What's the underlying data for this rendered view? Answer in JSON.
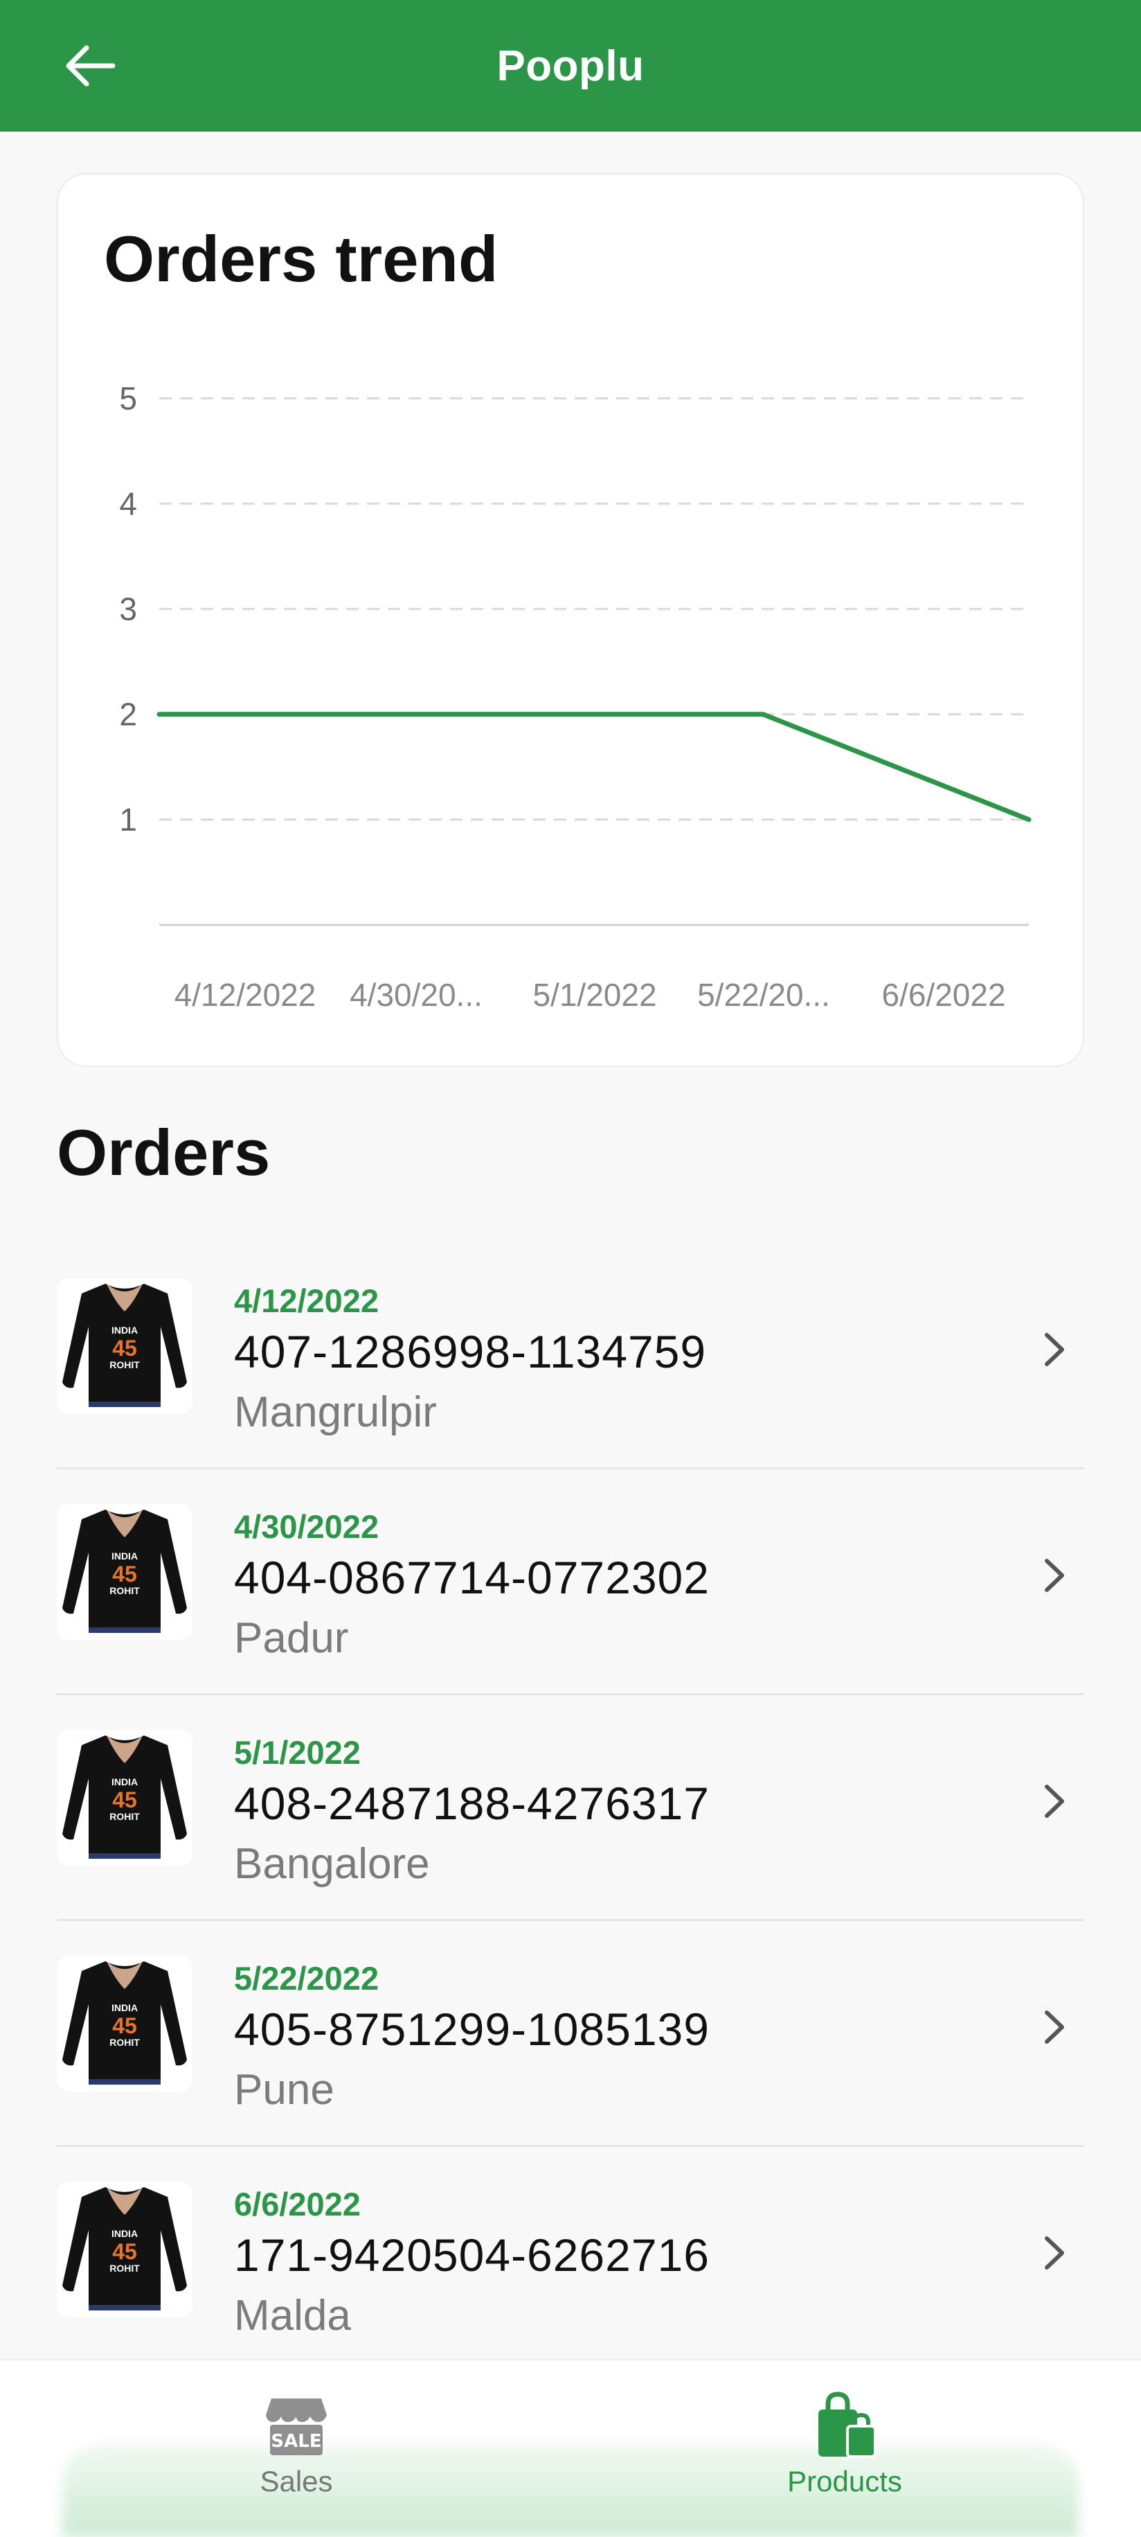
{
  "app": {
    "title": "Pooplu"
  },
  "chart_data": {
    "type": "line",
    "title": "Orders trend",
    "xlabel": "",
    "ylabel": "",
    "categories": [
      "4/12/2022",
      "4/30/20...",
      "5/1/2022",
      "5/22/20...",
      "6/6/2022"
    ],
    "series": [
      {
        "values": [
          2,
          2,
          2,
          2,
          1
        ]
      }
    ],
    "yticks": [
      1,
      2,
      3,
      4,
      5
    ],
    "ylim": [
      0,
      5
    ],
    "grid": true,
    "color": "#2b9648"
  },
  "orders_section": {
    "title": "Orders"
  },
  "orders": [
    {
      "date": "4/12/2022",
      "id": "407-1286998-1134759",
      "city": "Mangrulpir"
    },
    {
      "date": "4/30/2022",
      "id": "404-0867714-0772302",
      "city": "Padur"
    },
    {
      "date": "5/1/2022",
      "id": "408-2487188-4276317",
      "city": "Bangalore"
    },
    {
      "date": "5/22/2022",
      "id": "405-8751299-1085139",
      "city": "Pune"
    },
    {
      "date": "6/6/2022",
      "id": "171-9420504-6262716",
      "city": "Malda"
    }
  ],
  "thumbnail": {
    "shirt_text_top": "INDIA",
    "shirt_text_number": "45",
    "shirt_text_bottom": "ROHIT"
  },
  "bottom_nav": {
    "sales_label": "Sales",
    "sales_icon": "store-sale-icon",
    "products_label": "Products",
    "products_icon": "shopping-bags-icon",
    "active": "Products"
  },
  "colors": {
    "primary": "#2b9648",
    "inactive": "#777777"
  }
}
